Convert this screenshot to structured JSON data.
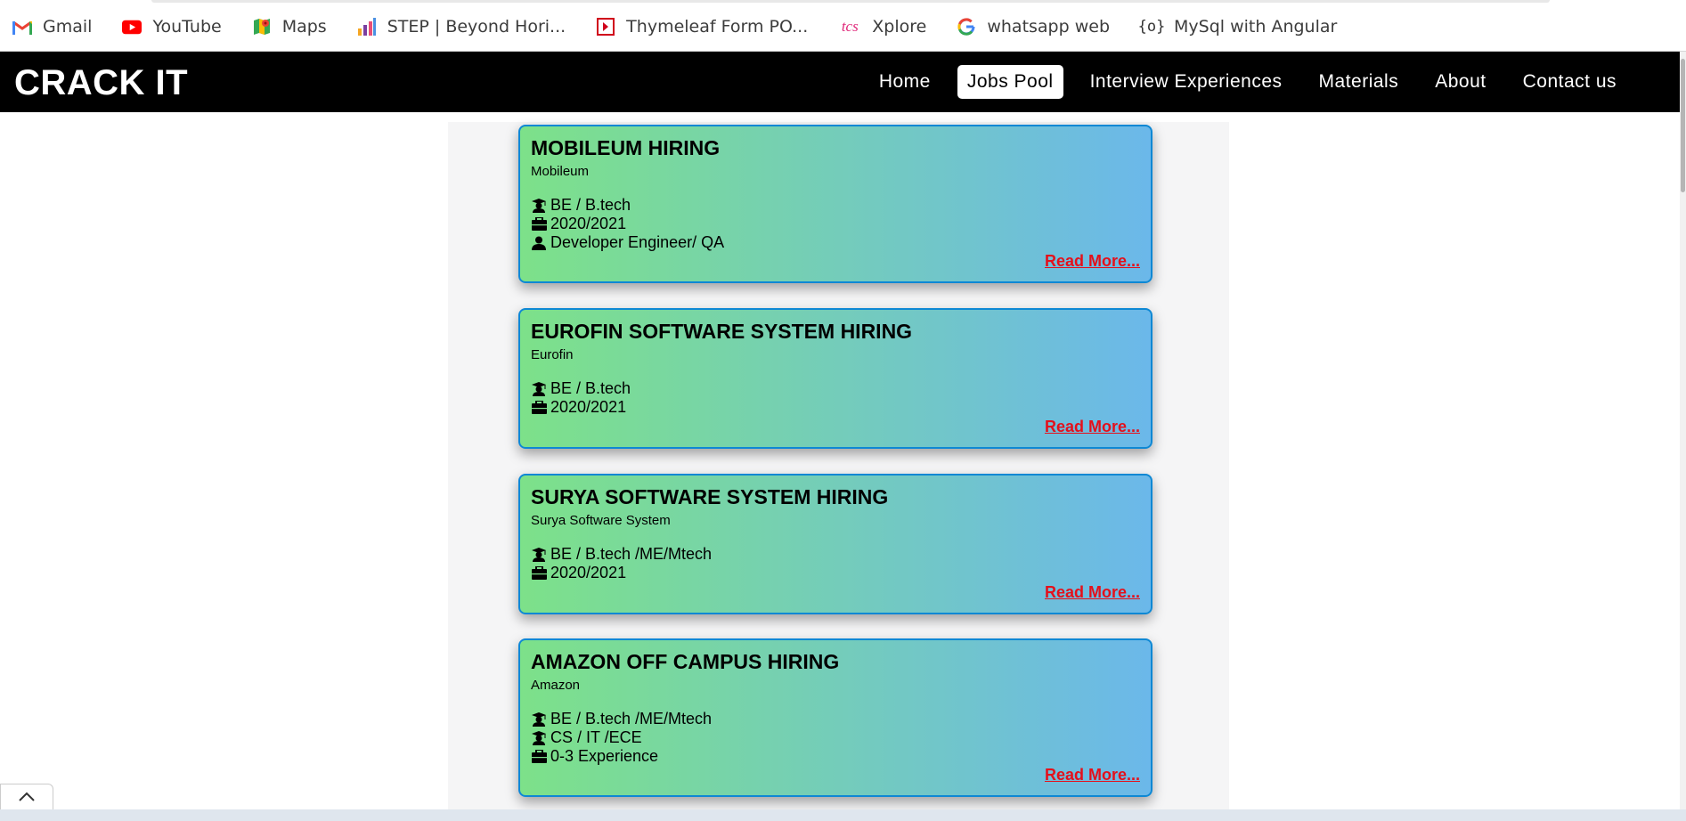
{
  "bookmarks": [
    {
      "label": "Gmail",
      "icon": "gmail-icon"
    },
    {
      "label": "YouTube",
      "icon": "youtube-icon"
    },
    {
      "label": "Maps",
      "icon": "maps-icon"
    },
    {
      "label": "STEP | Beyond Hori...",
      "icon": "step-icon"
    },
    {
      "label": "Thymeleaf Form PO...",
      "icon": "thymeleaf-icon"
    },
    {
      "label": "Xplore",
      "icon": "tcs-icon"
    },
    {
      "label": "whatsapp web",
      "icon": "google-icon"
    },
    {
      "label": "MySql with Angular",
      "icon": "code-icon"
    }
  ],
  "navbar": {
    "brand": "CRACK IT",
    "links": [
      "Home",
      "Jobs Pool",
      "Interview Experiences",
      "Materials",
      "About",
      "Contact us"
    ],
    "active": "Jobs Pool"
  },
  "jobs": [
    {
      "title": "MOBILEUM HIRING",
      "company": "Mobileum",
      "details": [
        {
          "icon": "graduate-icon",
          "text": "BE / B.tech"
        },
        {
          "icon": "briefcase-icon",
          "text": "2020/2021"
        },
        {
          "icon": "user-icon",
          "text": "Developer Engineer/ QA"
        }
      ],
      "read_more": "Read More..."
    },
    {
      "title": "EUROFIN SOFTWARE SYSTEM HIRING",
      "company": "Eurofin",
      "details": [
        {
          "icon": "graduate-icon",
          "text": "BE / B.tech"
        },
        {
          "icon": "briefcase-icon",
          "text": "2020/2021"
        }
      ],
      "read_more": "Read More..."
    },
    {
      "title": "SURYA SOFTWARE SYSTEM HIRING",
      "company": "Surya Software System",
      "details": [
        {
          "icon": "graduate-icon",
          "text": "BE / B.tech /ME/Mtech"
        },
        {
          "icon": "briefcase-icon",
          "text": "2020/2021"
        }
      ],
      "read_more": "Read More..."
    },
    {
      "title": "AMAZON OFF CAMPUS HIRING",
      "company": "Amazon",
      "details": [
        {
          "icon": "graduate-icon",
          "text": "BE / B.tech /ME/Mtech"
        },
        {
          "icon": "graduate-icon",
          "text": "CS / IT /ECE"
        },
        {
          "icon": "briefcase-icon",
          "text": "0-3 Experience"
        }
      ],
      "read_more": "Read More..."
    }
  ],
  "colors": {
    "card_gradient_start": "#7de189",
    "card_gradient_end": "#6bb8ea",
    "card_border": "#0e88d4",
    "read_more": "#e4101b",
    "navbar_bg": "#000000"
  }
}
